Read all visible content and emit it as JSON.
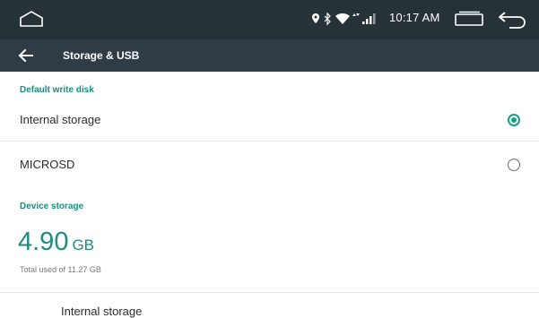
{
  "status_bar": {
    "time": "10:17 AM",
    "icons": [
      "location-icon",
      "bluetooth-icon",
      "wifi-icon",
      "signal-icon"
    ],
    "nav_icons": [
      "home-icon",
      "recents-icon",
      "back-icon"
    ]
  },
  "app_bar": {
    "title": "Storage & USB",
    "up_icon": "back-arrow-icon",
    "background": "#2f3c45"
  },
  "default_write_disk": {
    "header": "Default write disk",
    "options": [
      {
        "label": "Internal storage",
        "selected": true
      },
      {
        "label": "MICROSD",
        "selected": false
      }
    ]
  },
  "device_storage": {
    "header": "Device storage",
    "used_value": "4.90",
    "used_unit": "GB",
    "total_text": "Total used of 11.27 GB",
    "partial_item_label": "Internal storage"
  },
  "colors": {
    "accent": "#17a08b",
    "status_bar": "#263238",
    "text_primary": "#2b2b2b"
  }
}
